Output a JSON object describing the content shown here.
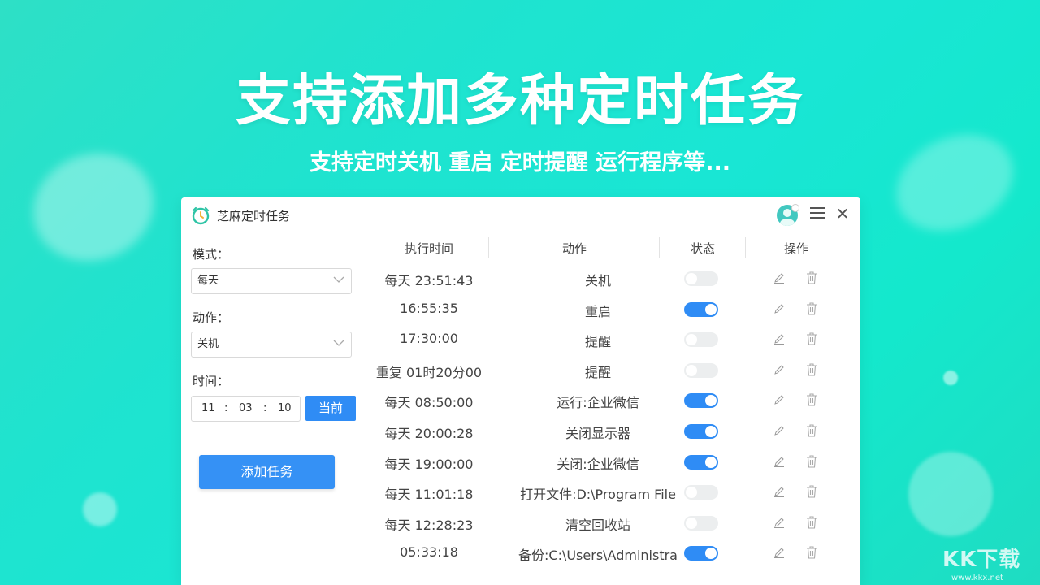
{
  "banner": {
    "headline": "支持添加多种定时任务",
    "subline": "支持定时关机 重启 定时提醒 运行程序等..."
  },
  "window": {
    "title": "芝麻定时任务",
    "icons": [
      "clock-icon",
      "avatar-icon",
      "menu-icon",
      "close-icon"
    ]
  },
  "form": {
    "mode_label": "模式：",
    "mode_value": "每天",
    "action_label": "动作：",
    "action_value": "关机",
    "time_label": "时间：",
    "time_hour": "11",
    "time_minute": "03",
    "time_second": "10",
    "time_sep": ":",
    "now_button": "当前",
    "add_button": "添加任务"
  },
  "table": {
    "headers": {
      "time": "执行时间",
      "action": "动作",
      "status": "状态",
      "ops": "操作"
    },
    "rows": [
      {
        "time": "每天 23:51:43",
        "action": "关机",
        "enabled": false
      },
      {
        "time": "16:55:35",
        "action": "重启",
        "enabled": true
      },
      {
        "time": "17:30:00",
        "action": "提醒",
        "enabled": false
      },
      {
        "time": "重复 01时20分00",
        "action": "提醒",
        "enabled": false
      },
      {
        "time": "每天 08:50:00",
        "action": "运行:企业微信",
        "enabled": true
      },
      {
        "time": "每天 20:00:28",
        "action": "关闭显示器",
        "enabled": true
      },
      {
        "time": "每天 19:00:00",
        "action": "关闭:企业微信",
        "enabled": true
      },
      {
        "time": "每天 11:01:18",
        "action": "打开文件:D:\\Program  File",
        "enabled": false
      },
      {
        "time": "每天 12:28:23",
        "action": "清空回收站",
        "enabled": false
      },
      {
        "time": "05:33:18",
        "action": "备份:C:\\Users\\Administra",
        "enabled": true
      }
    ]
  },
  "colors": {
    "accent": "#2f8cf5",
    "toggle_off": "#eceeef",
    "background": "#1fe3cf"
  },
  "watermark": {
    "logo": "KK下载",
    "url": "www.kkx.net"
  }
}
